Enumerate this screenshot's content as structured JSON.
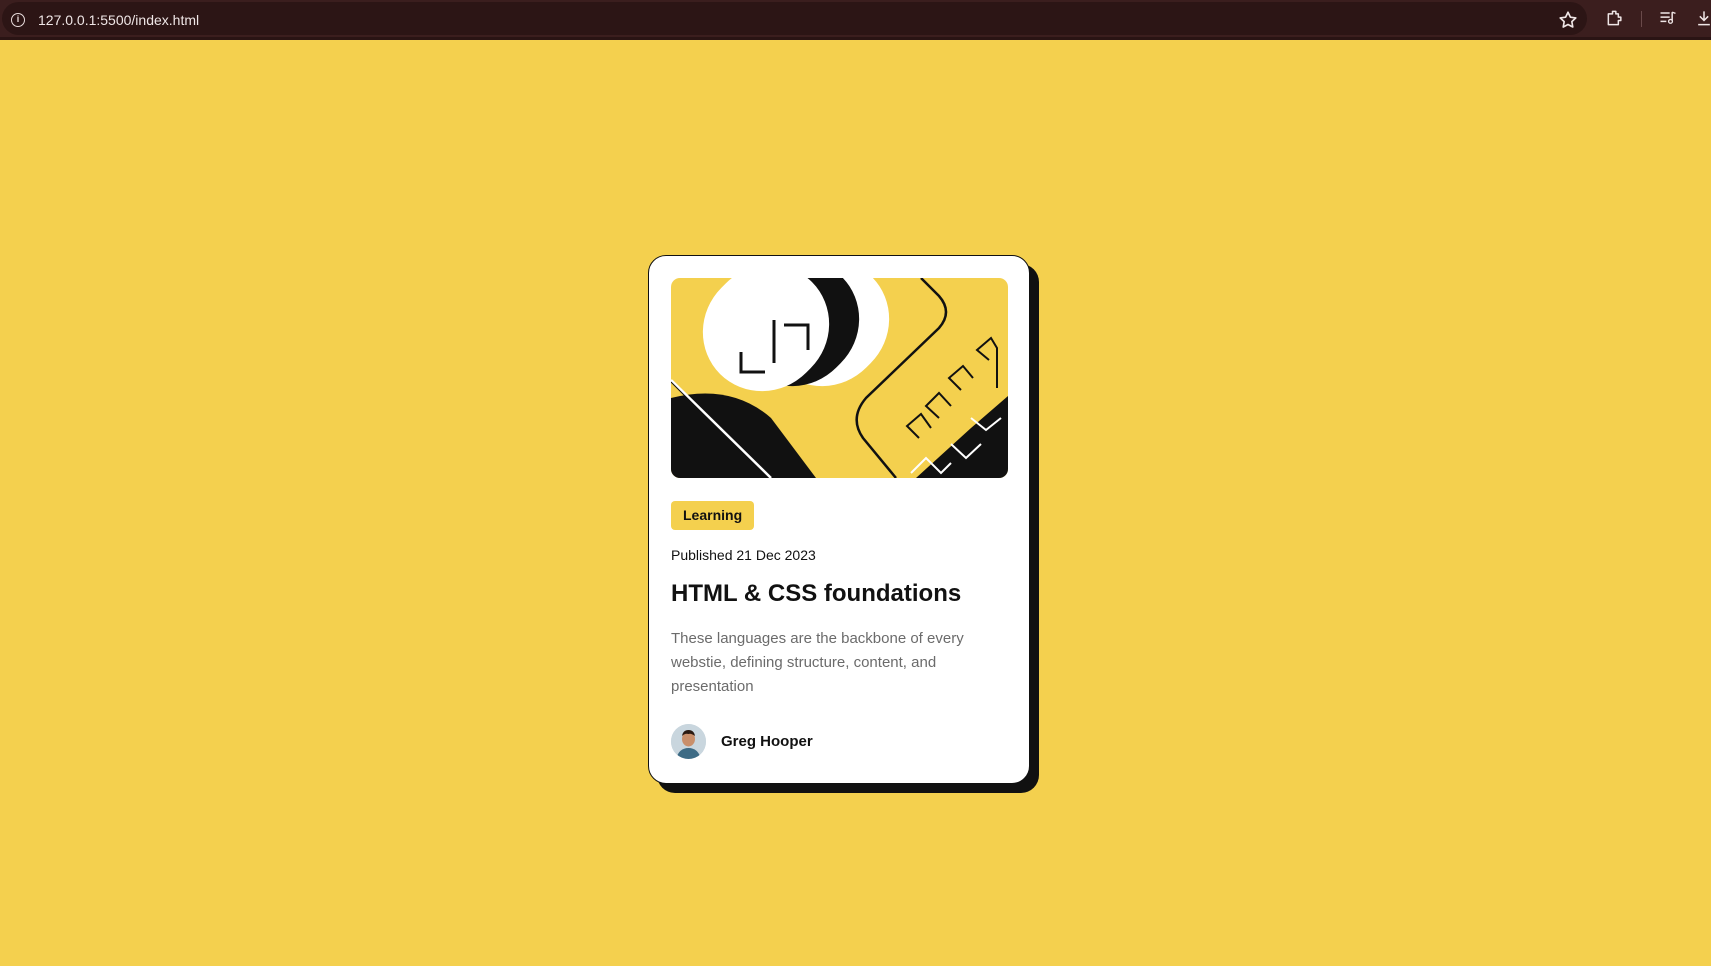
{
  "browser": {
    "url": "127.0.0.1:5500/index.html",
    "icons": [
      "info-icon",
      "star-icon",
      "extensions-icon",
      "media-icon",
      "download-icon"
    ]
  },
  "colors": {
    "background": "#f4d04e",
    "card": "#ffffff",
    "accent": "#f4d04e",
    "text_dark": "#111111",
    "text_muted": "#6b6b6b"
  },
  "card": {
    "tag": "Learning",
    "published": "Published 21 Dec 2023",
    "title": "HTML & CSS foundations",
    "description": "These languages are the backbone of every webstie, defining structure, content, and presentation",
    "author": {
      "name": "Greg Hooper",
      "avatar_icon": "avatar-photo"
    },
    "illustration_icon": "code-brackets-illustration"
  }
}
